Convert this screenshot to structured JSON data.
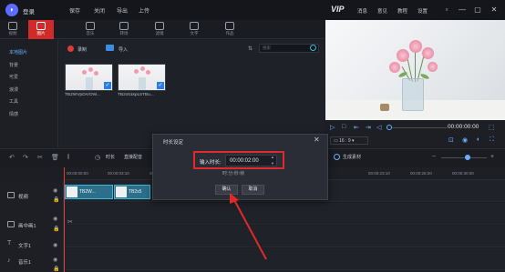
{
  "titlebar": {
    "login": "登录",
    "menu": [
      "保存",
      "关闭",
      "导出",
      "上传"
    ],
    "vip": "VIP",
    "right_menu": [
      "消息",
      "意见",
      "教程",
      "设置"
    ],
    "window_controls": [
      "▫",
      "—",
      "▢",
      "✕"
    ]
  },
  "toolbar": {
    "tabs": [
      "视频",
      "图片",
      "音乐",
      "转场",
      "滤镜",
      "文字",
      "作品"
    ]
  },
  "leftnav": {
    "items": [
      "本地图片",
      "背景",
      "可爱",
      "浪漫",
      "工具",
      "情感"
    ]
  },
  "media": {
    "record_label": "录制",
    "import_label": "导入",
    "search_placeholder": "搜索",
    "thumbnails": [
      {
        "caption": "TB2WVpDiVOW..."
      },
      {
        "caption": "TB2x51kpL5TBu..."
      }
    ]
  },
  "player": {
    "timecode": "00:00:00:00",
    "ratio": "16 : 9"
  },
  "timeline": {
    "time_label": "时长",
    "font_label": "直接配音",
    "generate_label": "生成素材",
    "ticks": [
      "00:00:00:00",
      "00:00:03:10",
      "00:00:06:20",
      "00:00:23:10",
      "00:00:26:20",
      "00:00:30:00"
    ],
    "tracks": [
      {
        "label": "视频"
      },
      {
        "label": "画中画1"
      },
      {
        "label": "文字1"
      },
      {
        "label": "音乐1"
      }
    ],
    "clips": [
      "TB2W...",
      "TB2x5"
    ]
  },
  "dialog": {
    "title": "时长设定",
    "field_label": "输入时长:",
    "field_value": "00:00:02:00",
    "format_hint": "时:分:秒:帧",
    "ok_label": "确认",
    "cancel_label": "取消"
  },
  "colors": {
    "accent": "#d02a2a",
    "highlight": "#e02a2a",
    "link": "#6ab0ff",
    "clip": "#3fb8d8"
  }
}
